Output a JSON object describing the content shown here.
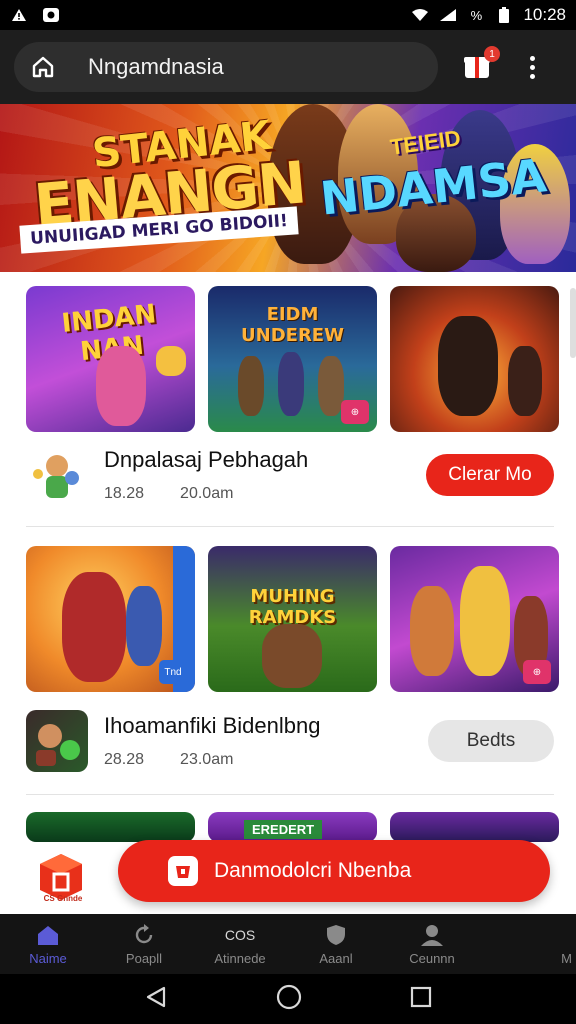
{
  "status_bar": {
    "time": "10:28",
    "battery_text": "%",
    "icons": [
      "alert-icon",
      "photo-icon",
      "wifi-icon",
      "signal-icon",
      "battery-icon"
    ]
  },
  "app_bar": {
    "url": "Nngamdnasia",
    "gift_badge": "1",
    "icons": [
      "home-icon",
      "gift-icon",
      "more-vertical-icon"
    ]
  },
  "banner": {
    "title_line1": "STANAK",
    "title_line2": "ENANGN",
    "subtitle": "UNUIIGAD MERI GO BIDOII!",
    "tag_line1": "TEIEID",
    "tag_line2": "NDAMSA"
  },
  "sections": [
    {
      "thumbnails": [
        {
          "label": "INDAN NAN",
          "corner": ""
        },
        {
          "label": "EIDM UNDEREW",
          "corner": "⊕"
        },
        {
          "label": "",
          "corner": ""
        }
      ],
      "app_name": "Dnpalasaj Pebhagah",
      "stat1": "18.28",
      "stat2": "20.0am",
      "button_label": "Clerar Mo"
    },
    {
      "thumbnails": [
        {
          "label": "",
          "corner": "Tnd"
        },
        {
          "label": "MUHING RAMDKS",
          "corner": ""
        },
        {
          "label": "",
          "corner": "⊕"
        }
      ],
      "app_name": "Ihoamanfiki Bidenlbng",
      "stat1": "28.28",
      "stat2": "23.0am",
      "button_label": "Bedts"
    }
  ],
  "third_row_label": "EREDERT",
  "fab": {
    "label": "Danmodolcri Nbenba",
    "logo_text": "CS Gnnde"
  },
  "bottom_nav": [
    {
      "label": "Naime",
      "icon": "home-icon",
      "active": true
    },
    {
      "label": "Poapll",
      "icon": "refresh-icon",
      "active": false
    },
    {
      "label": "Atinnede",
      "icon": "controller-icon",
      "active": false,
      "icon_text": "COS"
    },
    {
      "label": "Aaanl",
      "icon": "shield-icon",
      "active": false
    },
    {
      "label": "Ceunnn",
      "icon": "profile-icon",
      "active": false
    },
    {
      "label": "M",
      "icon": "",
      "active": false
    }
  ],
  "colors": {
    "accent_red": "#e8251a",
    "nav_active": "#5b5bd6",
    "app_bar": "#1e1e1e"
  }
}
